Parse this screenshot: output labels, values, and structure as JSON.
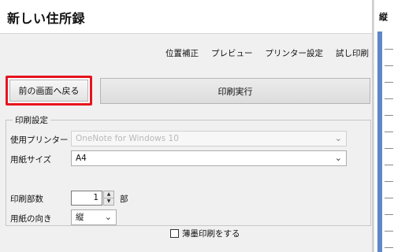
{
  "app": {
    "title": "新しい住所録"
  },
  "menu": {
    "items": [
      "位置補正",
      "プレビュー",
      "プリンター設定",
      "試し印刷"
    ]
  },
  "buttons": {
    "back_label": "前の画面へ戻る",
    "print_label": "印刷実行"
  },
  "print_settings": {
    "legend": "印刷設定",
    "printer": {
      "label": "使用プリンター",
      "value": "OneNote for Windows 10",
      "disabled": true
    },
    "paper_size": {
      "label": "用紙サイズ",
      "value": "A4"
    },
    "copies": {
      "label": "印刷部数",
      "value": "1",
      "unit": "部"
    },
    "orientation": {
      "label": "用紙の向き",
      "value": "縦"
    },
    "light_ink": {
      "label": "薄墨印刷をする",
      "checked": false
    }
  },
  "preview": {
    "header": "縦"
  },
  "icons": {
    "dropdown": "chevron-down-icon",
    "spin_up": "triangle-up-icon",
    "spin_down": "triangle-down-icon"
  },
  "colors": {
    "highlight_border": "#e8141e",
    "preview_bar": "#5b88c6"
  }
}
